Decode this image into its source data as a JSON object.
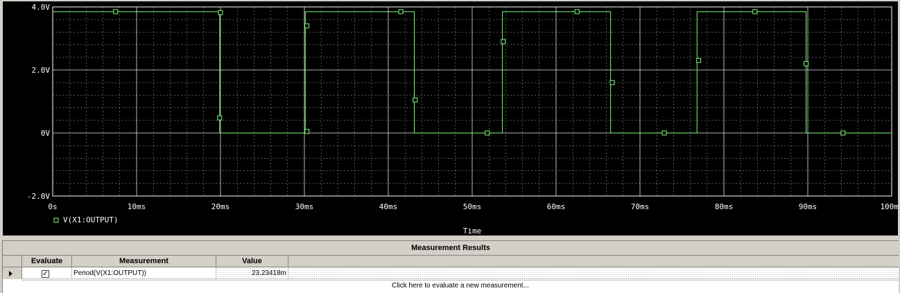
{
  "plot": {
    "x_axis_label": "Time",
    "legend_label": "V(X1:OUTPUT)",
    "colors": {
      "background": "#000000",
      "grid": "#ffffff",
      "trace": "#7cff7c"
    }
  },
  "chart_data": {
    "type": "line",
    "title": "",
    "xlabel": "Time",
    "ylabel": "",
    "xlim": [
      0,
      100
    ],
    "ylim": [
      -2,
      4
    ],
    "x_unit": "ms",
    "x_ticks": [
      "0s",
      "10ms",
      "20ms",
      "30ms",
      "40ms",
      "50ms",
      "60ms",
      "70ms",
      "80ms",
      "90ms",
      "100ms"
    ],
    "y_ticks": [
      {
        "value": 4,
        "label": "4.0V"
      },
      {
        "value": 2,
        "label": "2.0V"
      },
      {
        "value": 0,
        "label": "0V"
      },
      {
        "value": -2,
        "label": "-2.0V"
      }
    ],
    "grid": true,
    "legend": "bottom-left",
    "series": [
      {
        "name": "V(X1:OUTPUT)",
        "x": [
          0,
          19.9,
          19.9,
          30.1,
          30.1,
          43.1,
          43.1,
          53.6,
          53.6,
          66.5,
          66.5,
          76.8,
          76.8,
          89.8,
          89.8,
          100
        ],
        "y": [
          3.85,
          3.85,
          0,
          0,
          3.85,
          3.85,
          0,
          0,
          3.85,
          3.85,
          0,
          0,
          3.85,
          3.85,
          0,
          0
        ],
        "markers": [
          {
            "x": 7.5,
            "y": 3.85
          },
          {
            "x": 20.0,
            "y": 3.82
          },
          {
            "x": 19.9,
            "y": 0.48
          },
          {
            "x": 30.3,
            "y": 3.4
          },
          {
            "x": 30.3,
            "y": 0.05
          },
          {
            "x": 41.5,
            "y": 3.85
          },
          {
            "x": 43.2,
            "y": 1.05
          },
          {
            "x": 51.8,
            "y": 0.0
          },
          {
            "x": 53.7,
            "y": 2.9
          },
          {
            "x": 62.5,
            "y": 3.85
          },
          {
            "x": 66.7,
            "y": 1.6
          },
          {
            "x": 72.9,
            "y": 0.0
          },
          {
            "x": 77.0,
            "y": 2.3
          },
          {
            "x": 83.7,
            "y": 3.85
          },
          {
            "x": 89.8,
            "y": 2.2
          },
          {
            "x": 94.2,
            "y": 0.0
          }
        ]
      }
    ]
  },
  "results": {
    "title": "Measurement Results",
    "columns": [
      "Evaluate",
      "Measurement",
      "Value"
    ],
    "rows": [
      {
        "evaluate": "✓",
        "measurement": "Period(V(X1:OUTPUT))",
        "value": "23.23418m"
      }
    ],
    "new_row_text": "Click here to evaluate a new measurement..."
  }
}
